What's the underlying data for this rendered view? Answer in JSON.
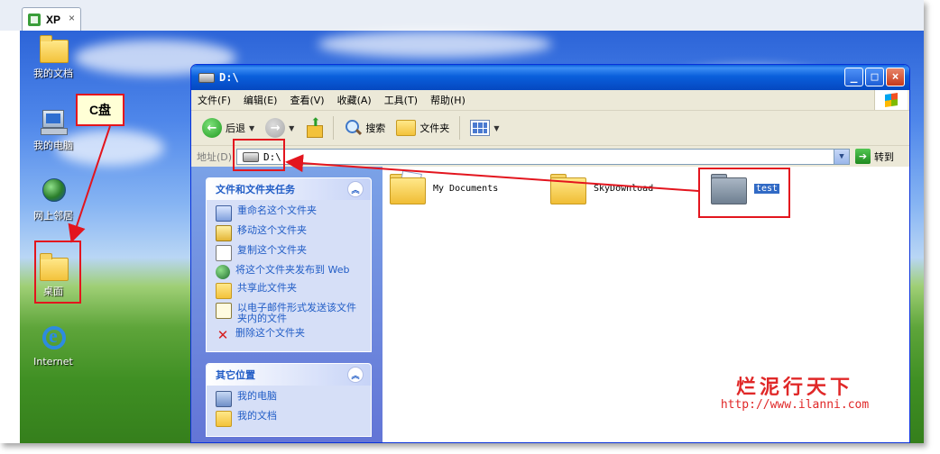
{
  "vm_tab": {
    "title": "XP",
    "close": "×"
  },
  "desktop": {
    "icons": [
      {
        "label": "我的文档"
      },
      {
        "label": "我的电脑"
      },
      {
        "label": "网上邻居"
      },
      {
        "label": "桌面"
      },
      {
        "label": "Internet"
      }
    ]
  },
  "annotation": {
    "callout": "C盘",
    "accent": "#e3151e"
  },
  "window": {
    "title": "D:\\",
    "buttons": {
      "minimize": "_",
      "maximize": "□",
      "close": "×"
    },
    "menu": [
      "文件(F)",
      "编辑(E)",
      "查看(V)",
      "收藏(A)",
      "工具(T)",
      "帮助(H)"
    ],
    "toolbar": {
      "back": "后退",
      "search": "搜索",
      "folders": "文件夹"
    },
    "address": {
      "label": "地址(D)",
      "value": "D:\\",
      "go": "转到"
    },
    "tasks_panel": {
      "title": "文件和文件夹任务",
      "items": [
        "重命名这个文件夹",
        "移动这个文件夹",
        "复制这个文件夹",
        "将这个文件夹发布到 Web",
        "共享此文件夹",
        "以电子邮件形式发送该文件夹内的文件",
        "删除这个文件夹"
      ]
    },
    "places_panel": {
      "title": "其它位置",
      "items": [
        "我的电脑",
        "我的文档"
      ]
    },
    "files": [
      {
        "name": "My Documents"
      },
      {
        "name": "SkyDownload"
      },
      {
        "name": "test"
      }
    ]
  },
  "watermark": {
    "brand": "烂泥行天下",
    "url": "http://www.ilanni.com"
  }
}
